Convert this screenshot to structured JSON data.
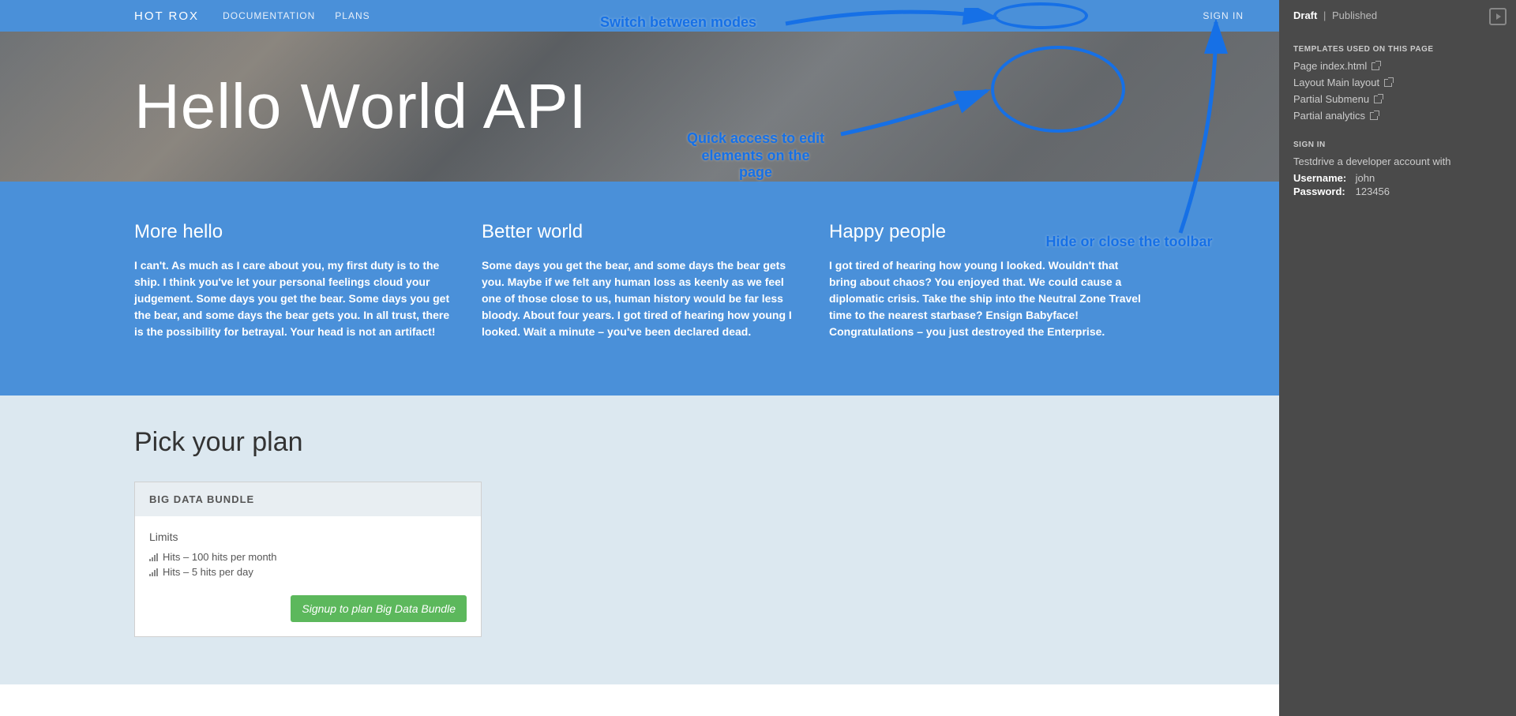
{
  "nav": {
    "brand": "HOT ROX",
    "links": [
      "DOCUMENTATION",
      "PLANS"
    ],
    "signin": "SIGN IN"
  },
  "hero": {
    "title": "Hello World API"
  },
  "columns": [
    {
      "title": "More hello",
      "body": "I can't. As much as I care about you, my first duty is to the ship. I think you've let your personal feelings cloud your judgement. Some days you get the bear. Some days you get the bear, and some days the bear gets you. In all trust, there is the possibility for betrayal. Your head is not an artifact!"
    },
    {
      "title": "Better world",
      "body": "Some days you get the bear, and some days the bear gets you. Maybe if we felt any human loss as keenly as we feel one of those close to us, human history would be far less bloody. About four years. I got tired of hearing how young I looked. Wait a minute – you've been declared dead."
    },
    {
      "title": "Happy people",
      "body": "I got tired of hearing how young I looked. Wouldn't that bring about chaos? You enjoyed that. We could cause a diplomatic crisis. Take the ship into the Neutral Zone Travel time to the nearest starbase? Ensign Babyface! Congratulations – you just destroyed the Enterprise."
    }
  ],
  "plans": {
    "heading": "Pick your plan",
    "card": {
      "title": "BIG DATA BUNDLE",
      "limits_label": "Limits",
      "limits": [
        "Hits – 100 hits per month",
        "Hits – 5 hits per day"
      ],
      "button": "Signup to plan Big Data Bundle"
    }
  },
  "sidebar": {
    "mode_draft": "Draft",
    "mode_published": "Published",
    "templates_heading": "TEMPLATES USED ON THIS PAGE",
    "templates": [
      "Page index.html",
      "Layout Main layout",
      "Partial Submenu",
      "Partial analytics"
    ],
    "signin_heading": "SIGN IN",
    "signin_text": "Testdrive a developer account with",
    "username_label": "Username:",
    "username_value": "john",
    "password_label": "Password:",
    "password_value": "123456"
  },
  "annotations": {
    "switch": "Switch between modes",
    "quick": "Quick access to edit\nelements on the\npage",
    "hide": "Hide or close the toolbar"
  }
}
